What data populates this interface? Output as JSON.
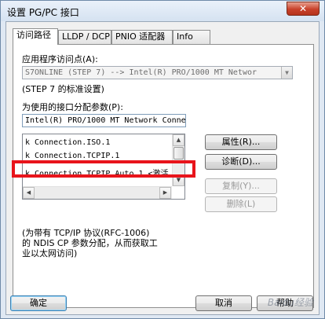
{
  "window": {
    "title": "设置 PG/PC 接口",
    "close_label": "✕"
  },
  "tabs": [
    {
      "label": "访问路径"
    },
    {
      "label": "LLDP / DCP"
    },
    {
      "label": "PNIO 适配器"
    },
    {
      "label": "Info"
    }
  ],
  "access_point": {
    "label": "应用程序访问点(A):",
    "value": "S7ONLINE (STEP 7)      --> Intel(R) PRO/1000 MT Networ",
    "note": "(STEP 7 的标准设置)"
  },
  "interface_params": {
    "label": "为使用的接口分配参数(P):",
    "value": "Intel(R) PRO/1000 MT Network Conne",
    "items": [
      "k Connection.ISO.1",
      "k Connection.TCPIP.1",
      "k Connection.TCPIP.Auto.1  <激活"
    ]
  },
  "description": "(为带有 TCP/IP 协议(RFC-1006)\n的 NDIS CP 参数分配，从而获取工\n业以太网访问)",
  "buttons": {
    "properties": "属性(R)...",
    "diagnostics": "诊断(D)...",
    "copy": "复制(Y)...",
    "delete": "删除(L)",
    "ok": "确定",
    "cancel": "取消",
    "help": "帮助"
  },
  "watermark": "Baidu经验",
  "colors": {
    "highlight": "#e8141b",
    "titlebar": "#dfe8f3"
  }
}
